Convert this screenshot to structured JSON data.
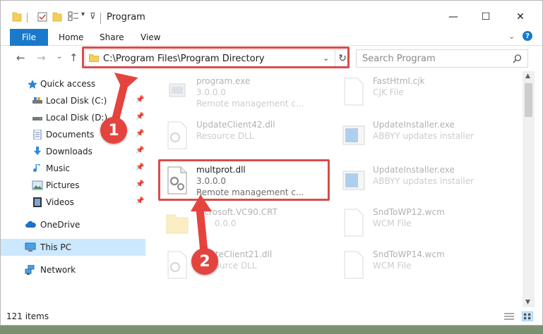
{
  "window": {
    "title": "Program",
    "controls": {
      "minimize": "—",
      "maximize": "☐",
      "close": "✕"
    }
  },
  "ribbon": {
    "tabs": [
      "File",
      "Home",
      "Share",
      "View"
    ],
    "expand": "⌄",
    "help": "?"
  },
  "address_bar": {
    "path": "C:\\Program Files\\Program Directory",
    "dropdown": "⌄",
    "refresh": "↻"
  },
  "search": {
    "placeholder": "Search Program"
  },
  "nav": {
    "back": "←",
    "forward": "→",
    "recent": "⌄",
    "up": "↑"
  },
  "sidebar": {
    "quick_access": "Quick access",
    "items": [
      {
        "label": "Local Disk (C:)",
        "icon": "drive-icon"
      },
      {
        "label": "Local Disk (D:)",
        "icon": "drive-icon"
      },
      {
        "label": "Documents",
        "icon": "documents-icon"
      },
      {
        "label": "Downloads",
        "icon": "downloads-icon"
      },
      {
        "label": "Music",
        "icon": "music-icon"
      },
      {
        "label": "Pictures",
        "icon": "pictures-icon"
      },
      {
        "label": "Videos",
        "icon": "videos-icon"
      }
    ],
    "onedrive": "OneDrive",
    "this_pc": "This PC",
    "network": "Network"
  },
  "files": [
    {
      "name": "program.exe",
      "l2": "3.0.0.0",
      "l3": "Remote management c...",
      "kind": "exe"
    },
    {
      "name": "FastHtml.cjk",
      "l2": "CJK File",
      "l3": "",
      "kind": "doc"
    },
    {
      "name": "UpdateClient42.dll",
      "l2": "Resource DLL",
      "l3": "",
      "kind": "dll"
    },
    {
      "name": "UpdateInstaller.exe",
      "l2": "ABBYY updates installer",
      "l3": "",
      "kind": "installer"
    },
    {
      "name": "multprot.dll",
      "l2": "3.0.0.0",
      "l3": "Remote management c...",
      "kind": "dll"
    },
    {
      "name": "UpdateInstaller.exe",
      "l2": "ABBYY updates installer",
      "l3": "",
      "kind": "installer"
    },
    {
      "name": "Microsoft.VC90.CRT",
      "l2": "",
      "l3": "",
      "kind": "folder"
    },
    {
      "name": "SndToWP12.wcm",
      "l2": "WCM File",
      "l3": "",
      "kind": "doc"
    },
    {
      "name": "UpdateClient21.dll",
      "l2": "Resource DLL",
      "l3": "",
      "kind": "dll"
    },
    {
      "name": "SndToWP14.wcm",
      "l2": "WCM File",
      "l3": "",
      "kind": "doc"
    }
  ],
  "partial_labels": {
    "vc90": "icrosoft.VC90.CRT",
    "vc90_l2": "0.0.0",
    "client21": "dateClient21.dll",
    "client21_l2": "esource DLL"
  },
  "status": {
    "items_count": "121 items"
  },
  "callouts": [
    "1",
    "2"
  ],
  "colors": {
    "accent": "#1979ca",
    "highlight": "#d94c4c",
    "callout": "#e5433e",
    "selected": "#cce8ff"
  }
}
